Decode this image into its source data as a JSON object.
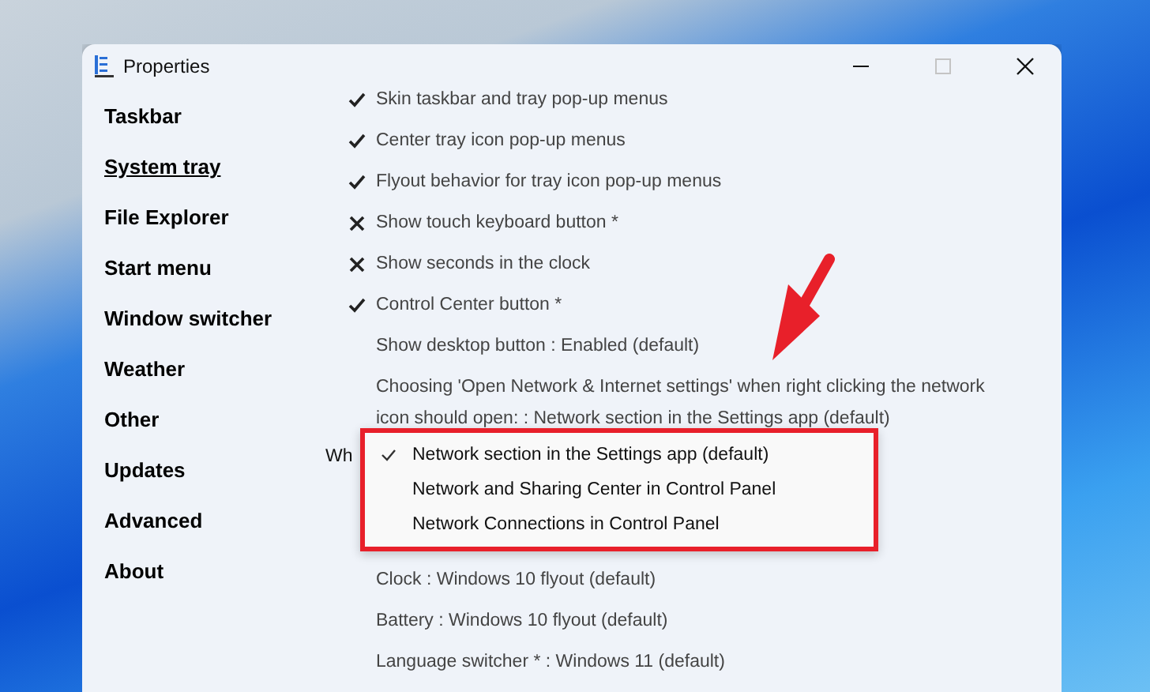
{
  "window": {
    "title": "Properties",
    "maximize_disabled": true
  },
  "sidebar": {
    "items": [
      {
        "label": "Taskbar",
        "selected": false
      },
      {
        "label": "System tray",
        "selected": true
      },
      {
        "label": "File Explorer",
        "selected": false
      },
      {
        "label": "Start menu",
        "selected": false
      },
      {
        "label": "Window switcher",
        "selected": false
      },
      {
        "label": "Weather",
        "selected": false
      },
      {
        "label": "Other",
        "selected": false
      },
      {
        "label": "Updates",
        "selected": false
      },
      {
        "label": "Advanced",
        "selected": false
      },
      {
        "label": "About",
        "selected": false
      }
    ]
  },
  "settings": [
    {
      "kind": "toggle",
      "label": "Skin taskbar and tray pop-up menus",
      "checked": true
    },
    {
      "kind": "toggle",
      "label": "Center tray icon pop-up menus",
      "checked": true
    },
    {
      "kind": "toggle",
      "label": "Flyout behavior for tray icon pop-up menus",
      "checked": true
    },
    {
      "kind": "toggle",
      "label": "Show touch keyboard button *",
      "checked": false
    },
    {
      "kind": "toggle",
      "label": "Show seconds in the clock",
      "checked": false
    },
    {
      "kind": "toggle",
      "label": "Control Center button *",
      "checked": true
    },
    {
      "kind": "text",
      "label": "Show desktop button : Enabled (default)"
    },
    {
      "kind": "text",
      "label": "Choosing 'Open Network & Internet settings' when right clicking the network icon should open: : Network section in the Settings app (default)"
    },
    {
      "kind": "dropdown",
      "label": "Wh",
      "options": [
        {
          "label": "Network section in the Settings app (default)",
          "selected": true
        },
        {
          "label": "Network and Sharing Center in Control Panel",
          "selected": false
        },
        {
          "label": "Network Connections in Control Panel",
          "selected": false
        }
      ]
    },
    {
      "kind": "text",
      "label": "Clock : Windows 10 flyout (default)"
    },
    {
      "kind": "text",
      "label": "Battery : Windows 10 flyout (default)"
    },
    {
      "kind": "text",
      "label": "Language switcher * : Windows 11 (default)"
    }
  ]
}
